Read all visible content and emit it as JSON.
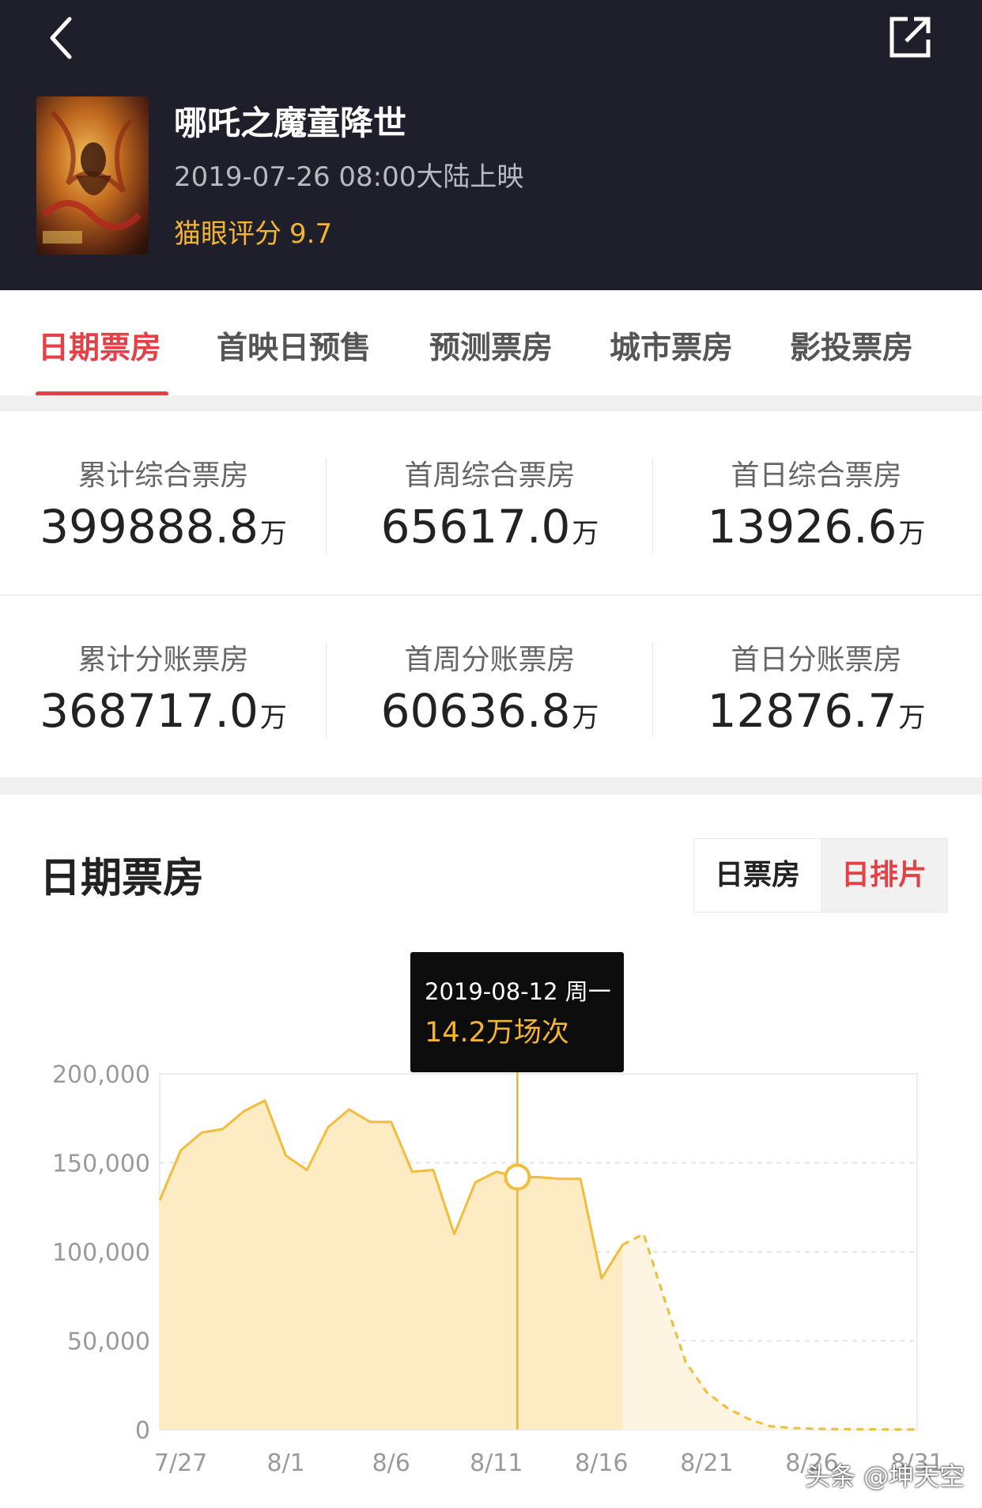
{
  "header": {
    "back_icon": "back-chevron-icon",
    "share_icon": "share-external-icon",
    "poster": "movie-poster",
    "title": "哪吒之魔童降世",
    "release": "2019-07-26 08:00大陆上映",
    "rating_label": "猫眼评分",
    "rating_value": "9.7"
  },
  "tabs": [
    {
      "label": "日期票房",
      "active": true
    },
    {
      "label": "首映日预售",
      "active": false
    },
    {
      "label": "预测票房",
      "active": false
    },
    {
      "label": "城市票房",
      "active": false
    },
    {
      "label": "影投票房",
      "active": false
    }
  ],
  "stats": [
    [
      {
        "label": "累计综合票房",
        "value": "399888.8",
        "unit": "万"
      },
      {
        "label": "首周综合票房",
        "value": "65617.0",
        "unit": "万"
      },
      {
        "label": "首日综合票房",
        "value": "13926.6",
        "unit": "万"
      }
    ],
    [
      {
        "label": "累计分账票房",
        "value": "368717.0",
        "unit": "万"
      },
      {
        "label": "首周分账票房",
        "value": "60636.8",
        "unit": "万"
      },
      {
        "label": "首日分账票房",
        "value": "12876.7",
        "unit": "万"
      }
    ]
  ],
  "section": {
    "title": "日期票房",
    "toggle_left": "日票房",
    "toggle_right": "日排片",
    "toggle_selected": "日排片"
  },
  "tooltip": {
    "date": "2019-08-12 周一",
    "value": "14.2万场次"
  },
  "watermark": "头条 @坤天空",
  "colors": {
    "header_bg": "#1f1f2b",
    "accent_red": "#e54045",
    "rating_gold": "#f3b432",
    "line": "#f1bd3b",
    "area_fill": "#fdebc4",
    "forecast_fill": "#fdf5e1"
  },
  "chart_data": {
    "type": "area",
    "ylim": [
      0,
      200000
    ],
    "yticks": [
      0,
      50000,
      100000,
      150000,
      200000
    ],
    "ytick_labels": [
      "0",
      "50,000",
      "100,000",
      "150,000",
      "200,000"
    ],
    "xtick_labels": [
      "7/27",
      "8/1",
      "8/6",
      "8/11",
      "8/16",
      "8/21",
      "8/26",
      "8/31"
    ],
    "x": [
      "7/26",
      "7/27",
      "7/28",
      "7/29",
      "7/30",
      "7/31",
      "8/1",
      "8/2",
      "8/3",
      "8/4",
      "8/5",
      "8/6",
      "8/7",
      "8/8",
      "8/9",
      "8/10",
      "8/11",
      "8/12",
      "8/13",
      "8/14",
      "8/15",
      "8/16",
      "8/17",
      "8/18",
      "8/19",
      "8/20",
      "8/21",
      "8/22",
      "8/23",
      "8/24",
      "8/25",
      "8/26",
      "8/27",
      "8/28",
      "8/29",
      "8/30",
      "8/31"
    ],
    "series": [
      {
        "values": [
          129000,
          157000,
          167000,
          169000,
          179000,
          185000,
          154000,
          146000,
          170000,
          180000,
          173000,
          173000,
          145000,
          146000,
          110000,
          139000,
          145000,
          142000,
          142000,
          141000,
          141000,
          85000,
          104000
        ]
      },
      {
        "values": [
          null,
          null,
          null,
          null,
          null,
          null,
          null,
          null,
          null,
          null,
          null,
          null,
          null,
          null,
          null,
          null,
          null,
          null,
          null,
          null,
          null,
          null,
          104000,
          110000,
          73000,
          38000,
          21000,
          12000,
          6000,
          2000,
          1000,
          600,
          400,
          300,
          200,
          150,
          100
        ]
      }
    ],
    "highlight": {
      "x": "8/12",
      "y": 142000
    }
  }
}
